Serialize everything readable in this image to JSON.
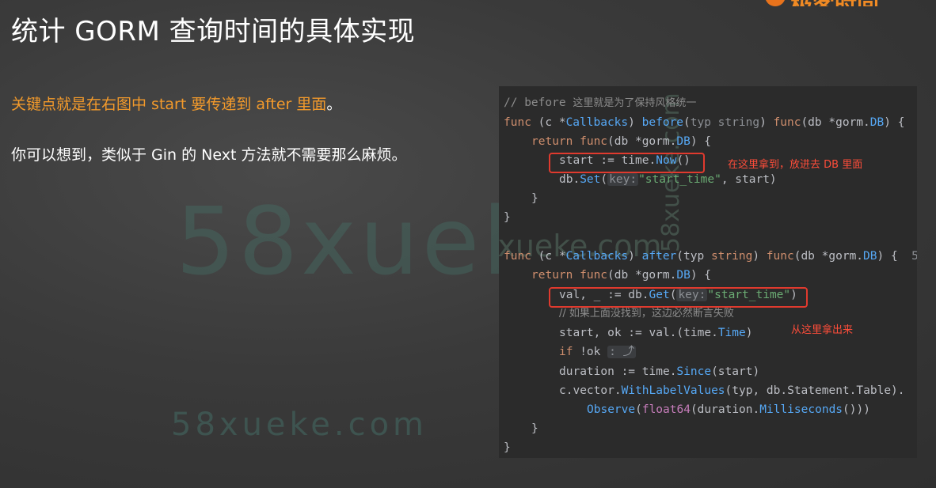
{
  "slide": {
    "title": "统计 GORM 查询时间的具体实现",
    "logo_text": "极客时间",
    "point1": "关键点就是在右图中 start 要传递到 after 里面",
    "point1_dot": "。",
    "point2": "你可以想到，类似于 Gin 的 Next 方法就不需要那么麻烦。"
  },
  "watermark": {
    "big": "58xueke.com",
    "small": "58xueke.com",
    "code_overlay": "58xueke.com",
    "code_vertical": "58xueke.com"
  },
  "code": {
    "l1_comment": "// before ",
    "l1_comment_zh": "这里就是为了保持风格统一",
    "l2": {
      "func": "func",
      "recv": " (c *",
      "recv_type": "Callbacks",
      "close": ") ",
      "name": "before",
      "params_open": "(",
      "p1": "typ",
      "p1_type": " string",
      "params_close": ") ",
      "func2": "func",
      "args": "(db *",
      "pkg": "gorm",
      "dot": ".",
      "db_type": "DB",
      "tail": ") {"
    },
    "l3": {
      "ret": "return ",
      "func": "func",
      "args": "(db *",
      "pkg": "gorm",
      "dot": ".",
      "db_type": "DB",
      "tail": ") {"
    },
    "l4": {
      "lhs": "start := ",
      "pkg": "time",
      "dot": ".",
      "fn": "Now",
      "tail": "()"
    },
    "l5": {
      "obj": "db.",
      "fn": "Set",
      "open": "(",
      "hint": "key:",
      "str": "\"start_time\"",
      "tail": ", start)"
    },
    "l6": "}",
    "l7": "}",
    "l8": {
      "func": "func",
      "recv": " (c *",
      "recv_type": "Callbacks",
      "close": ") ",
      "name": "after",
      "params_open": "(",
      "p1": "typ",
      "p1_type": " string",
      "params_close": ") ",
      "func2": "func",
      "args": "(db *",
      "pkg": "gorm",
      "dot": ".",
      "db_type": "DB",
      "tail": ") {",
      "extra": "5"
    },
    "l9": {
      "ret": "return ",
      "func": "func",
      "args": "(db *",
      "pkg": "gorm",
      "dot": ".",
      "db_type": "DB",
      "tail": ") {"
    },
    "l10": {
      "lhs": "val",
      "sep": ", _ := db.",
      "fn": "Get",
      "open": "(",
      "hint": "key:",
      "str": "\"start_time\"",
      "tail": ")"
    },
    "l11": "// 如果上面没找到，这边必然断言失败",
    "l12": {
      "lhs": "start",
      "sep": ", ok := val.(",
      "pkg": "time",
      "dot": ".",
      "type": "Time",
      "tail": ")"
    },
    "l13": {
      "kw": "if",
      "cond": " !ok ",
      "hint": ": ⤴"
    },
    "l14": {
      "lhs": "duration := ",
      "pkg": "time",
      "dot": ".",
      "fn": "Since",
      "tail": "(start)"
    },
    "l15": {
      "obj": "c.vector.",
      "fn": "WithLabelValues",
      "args": "(typ, db.Statement.Table)."
    },
    "l16": {
      "fn": "Observe",
      "open": "(",
      "fn2": "float64",
      "mid": "(duration.",
      "fn3": "Milliseconds",
      "tail": "()))"
    },
    "l17": "}",
    "l18": "}"
  },
  "annotations": {
    "a1": "在这里拿到，放进去 DB 里面",
    "a2": "从这里拿出来"
  }
}
